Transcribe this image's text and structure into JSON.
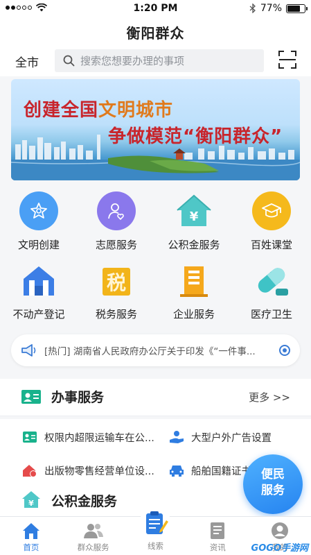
{
  "status_bar": {
    "time": "1:20 PM",
    "battery": "77%",
    "battery_level": 0.77
  },
  "header": {
    "title": "衡阳群众"
  },
  "search": {
    "city": "全市",
    "placeholder": "搜索您想要办理的事项"
  },
  "banner": {
    "line1_a": "创建全国",
    "line1_b": "文明城市",
    "line2": "争做模范“衡阳群众”"
  },
  "grid": [
    {
      "label": "文明创建",
      "icon": "flower-icon",
      "color": "#4a9ff5"
    },
    {
      "label": "志愿服务",
      "icon": "volunteer-icon",
      "color": "#8a78ec"
    },
    {
      "label": "公积金服务",
      "icon": "house-yuan-icon",
      "color": "#4fc7c7"
    },
    {
      "label": "百姓课堂",
      "icon": "graduation-cap-icon",
      "color": "#f5b91c"
    },
    {
      "label": "不动产登记",
      "icon": "building-icon",
      "color": "#3c7ee6"
    },
    {
      "label": "税务服务",
      "icon": "tax-icon",
      "color": "#f2b41a"
    },
    {
      "label": "企业服务",
      "icon": "office-building-icon",
      "color": "#f5a81c"
    },
    {
      "label": "医疗卫生",
      "icon": "pill-icon",
      "color": "#3fc3c6"
    }
  ],
  "notice": {
    "text": "[热门] 湖南省人民政府办公厅关于印发《“一件事..."
  },
  "section_banshi": {
    "title": "办事服务",
    "more": "更多 >>"
  },
  "services": [
    {
      "label": "权限内超限运输车在公...",
      "icon": "id-card-icon",
      "color": "#19b28c"
    },
    {
      "label": "大型户外广告设置",
      "icon": "hand-person-icon",
      "color": "#2f7de1"
    },
    {
      "label": "出版物零售经营单位设...",
      "icon": "house-warning-icon",
      "color": "#e54b4b"
    },
    {
      "label": "船舶国籍证书",
      "icon": "car-icon",
      "color": "#2f7de1"
    }
  ],
  "section_gjj": {
    "title": "公积金服务"
  },
  "fab": {
    "line1": "便民",
    "line2": "服务"
  },
  "tabs": [
    {
      "label": "首页",
      "icon": "home-icon",
      "active": true
    },
    {
      "label": "群众服务",
      "icon": "people-icon",
      "active": false
    },
    {
      "label": "线索",
      "icon": "clipboard-pen-icon",
      "active": false
    },
    {
      "label": "资讯",
      "icon": "news-icon",
      "active": false
    },
    {
      "label": "我的",
      "icon": "user-icon",
      "active": false
    }
  ],
  "watermark": "GOGO手游网"
}
